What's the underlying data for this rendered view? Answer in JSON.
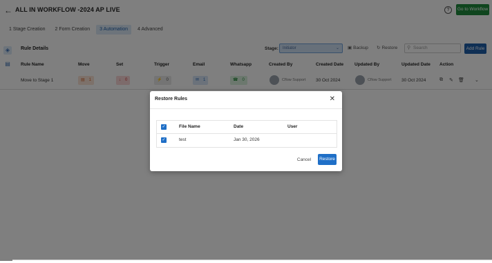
{
  "header": {
    "title": "ALL IN WORKFLOW -2024 AP LIVE",
    "go_to_workflow": "Go to Workflow",
    "help_glyph": "?"
  },
  "tabs": [
    {
      "label": "1 Stage Creation",
      "active": false
    },
    {
      "label": "2 Form Creation",
      "active": false
    },
    {
      "label": "3 Automation",
      "active": true
    },
    {
      "label": "4 Advanced",
      "active": false
    }
  ],
  "toolbar": {
    "section_title": "Rule Details",
    "stage_label": "Stage:",
    "stage_value": "Initiator",
    "backup_label": "Backup",
    "restore_label": "Restore",
    "search_placeholder": "Search",
    "add_rule_label": "Add Rule"
  },
  "table": {
    "headers": [
      "Rule Name",
      "Move",
      "Set",
      "Trigger",
      "Email",
      "Whatsapp",
      "Created By",
      "Created Date",
      "Updated By",
      "Updated Date",
      "Action"
    ],
    "rows": [
      {
        "rule_name": "Move to Stage 1",
        "move": "1",
        "set": "0",
        "trigger": "0",
        "email": "1",
        "whatsapp": "0",
        "created_by": "Cflow Support",
        "created_date": "30 Oct 2024",
        "updated_by": "Cflow Support",
        "updated_date": "30 Oct 2024"
      }
    ]
  },
  "modal": {
    "title": "Restore Rules",
    "columns": [
      "File Name",
      "Date",
      "User"
    ],
    "rows": [
      {
        "file_name": "test",
        "date": "Jan 30, 2026",
        "user": ""
      }
    ],
    "cancel_label": "Cancel",
    "restore_label": "Restore"
  },
  "colors": {
    "primary": "#1f5fa8",
    "go_button": "#1e8a3c",
    "checkbox": "#1f6fc7"
  }
}
